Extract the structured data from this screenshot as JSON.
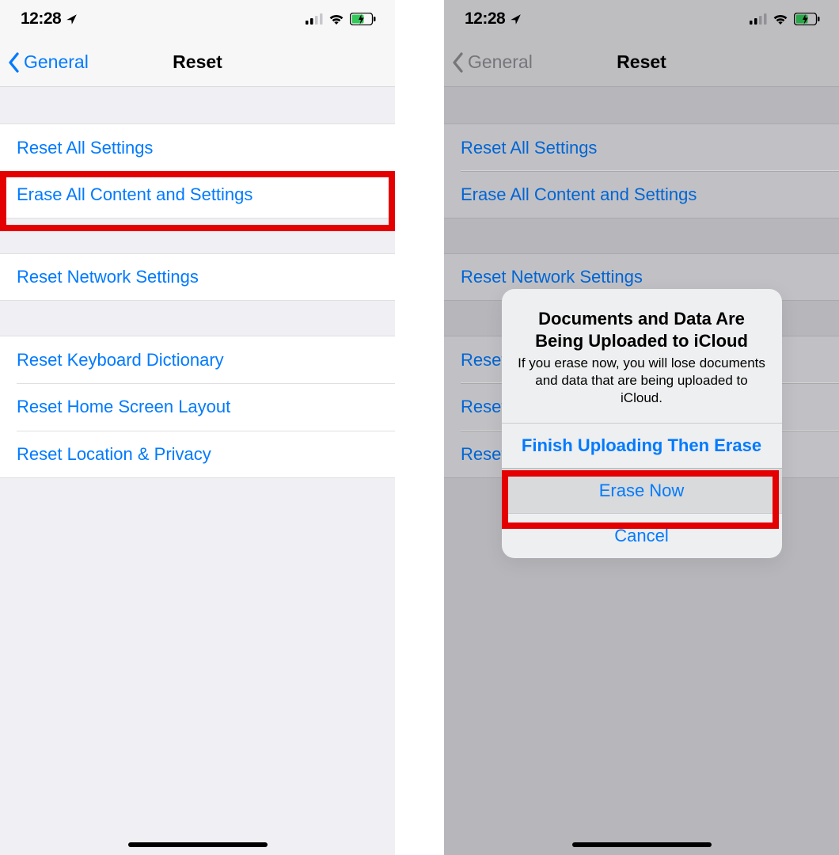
{
  "status": {
    "time": "12:28",
    "location_active": true
  },
  "nav": {
    "back_label": "General",
    "title": "Reset"
  },
  "groups": [
    {
      "cells": [
        {
          "label": "Reset All Settings"
        },
        {
          "label": "Erase All Content and Settings"
        }
      ]
    },
    {
      "cells": [
        {
          "label": "Reset Network Settings"
        }
      ]
    },
    {
      "cells": [
        {
          "label": "Reset Keyboard Dictionary"
        },
        {
          "label": "Reset Home Screen Layout"
        },
        {
          "label": "Reset Location & Privacy"
        }
      ]
    }
  ],
  "alert": {
    "title": "Documents and Data Are Being Uploaded to iCloud",
    "message": "If you erase now, you will lose documents and data that are being uploaded to iCloud.",
    "buttons": {
      "finish": "Finish Uploading Then Erase",
      "erase_now": "Erase Now",
      "cancel": "Cancel"
    }
  },
  "highlight": {
    "left": "erase-all-content",
    "right": "alert-erase-now"
  }
}
